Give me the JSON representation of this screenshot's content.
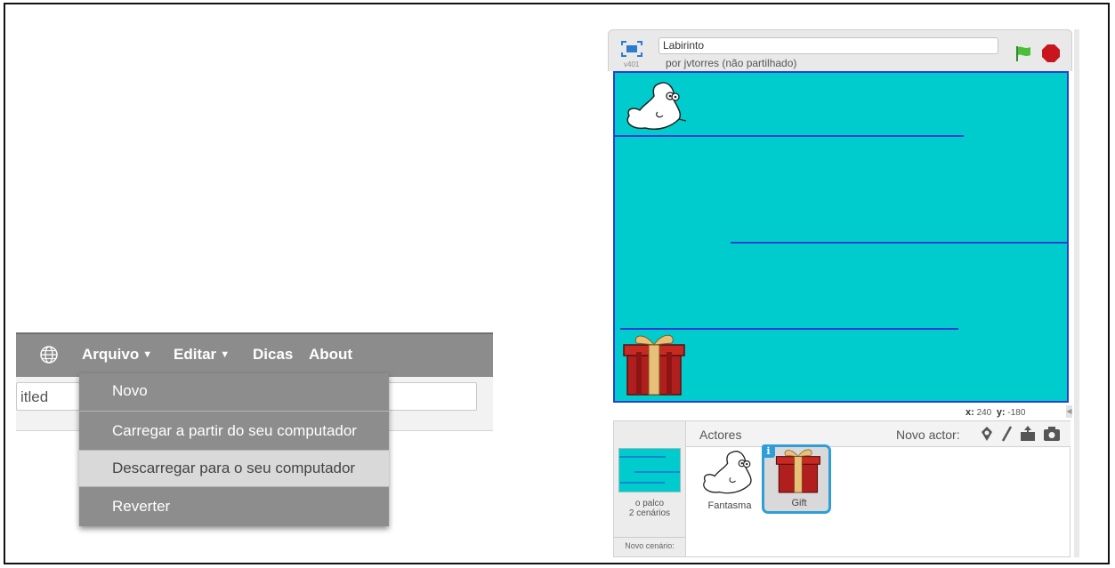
{
  "menu": {
    "globe_icon": "globe-icon",
    "items": [
      {
        "label": "Arquivo",
        "caret": "▼"
      },
      {
        "label": "Editar",
        "caret": "▼"
      },
      {
        "label": "Dicas"
      },
      {
        "label": "About"
      }
    ],
    "title_value": "itled",
    "dropdown": [
      {
        "label": "Novo"
      },
      {
        "label": "Carregar a partir do seu computador"
      },
      {
        "label": "Descarregar para o seu computador",
        "highlighted": true
      },
      {
        "label": "Reverter"
      }
    ]
  },
  "scratch": {
    "version": "v401",
    "project_title": "Labirinto",
    "author": "por jvtorres (não partilhado)",
    "coords": {
      "x_label": "x:",
      "x": "240",
      "y_label": "y:",
      "y": "-180"
    },
    "stage_color": "#00ccce",
    "wall_color": "#2a3fd0",
    "sprites_header": "Actores",
    "new_sprite_label": "Novo actor:",
    "stage_label": "o palco",
    "stage_count": "2 cenários",
    "new_backdrop_label": "Novo cenário:",
    "sprites": [
      {
        "name": "Fantasma",
        "icon": "ghost-icon"
      },
      {
        "name": "Gift",
        "icon": "gift-icon",
        "selected": true
      }
    ],
    "info_badge": "i"
  }
}
